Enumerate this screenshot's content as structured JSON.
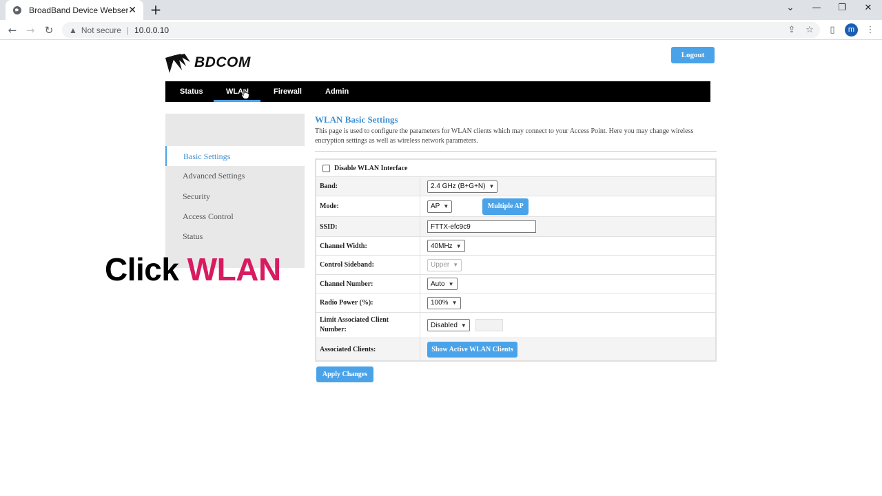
{
  "browser": {
    "tab_title": "BroadBand Device Webserver",
    "new_tab": "+",
    "security_label": "Not secure",
    "url": "10.0.0.10",
    "profile_initial": "m"
  },
  "header": {
    "brand": "BDCOM",
    "logout_label": "Logout"
  },
  "nav": {
    "items": [
      "Status",
      "WLAN",
      "Firewall",
      "Admin"
    ],
    "active": "WLAN"
  },
  "sidebar": {
    "items": [
      "Basic Settings",
      "Advanced Settings",
      "Security",
      "Access Control",
      "Status"
    ],
    "selected": "Basic Settings"
  },
  "overlay": {
    "word1": "Click",
    "word2": "WLAN",
    "word2_color": "#d81b60"
  },
  "content": {
    "title": "WLAN Basic Settings",
    "description": "This page is used to configure the parameters for WLAN clients which may connect to your Access Point. Here you may change wireless encryption settings as well as wireless network parameters."
  },
  "form": {
    "disable_label": "Disable WLAN Interface",
    "band_label": "Band:",
    "band_value": "2.4 GHz (B+G+N)",
    "mode_label": "Mode:",
    "mode_value": "AP",
    "multiple_ap_label": "Multiple AP",
    "ssid_label": "SSID:",
    "ssid_value": "FTTX-efc9c9",
    "channel_width_label": "Channel Width:",
    "channel_width_value": "40MHz",
    "control_sideband_label": "Control Sideband:",
    "control_sideband_value": "Upper",
    "channel_number_label": "Channel Number:",
    "channel_number_value": "Auto",
    "radio_power_label": "Radio Power (%):",
    "radio_power_value": "100%",
    "limit_clients_label_1": "Limit Associated Client",
    "limit_clients_label_2": "Number:",
    "limit_clients_value": "Disabled",
    "associated_clients_label": "Associated Clients:",
    "show_clients_label": "Show Active WLAN Clients",
    "apply_label": "Apply Changes"
  },
  "colors": {
    "accent": "#4aa3e8",
    "nav_bg": "#000000",
    "link": "#3a8fd4"
  }
}
